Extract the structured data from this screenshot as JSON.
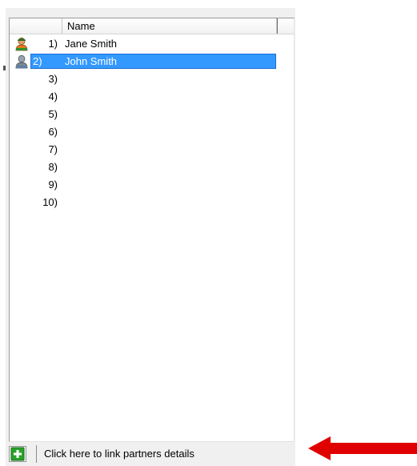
{
  "listview": {
    "column_header": "Name",
    "rows": [
      {
        "number": "1)",
        "name": "Jane Smith",
        "icon": "person-orange-icon",
        "selected": false
      },
      {
        "number": "2)",
        "name": "John Smith",
        "icon": "person-grey-icon",
        "selected": true
      },
      {
        "number": "3)",
        "name": ""
      },
      {
        "number": "4)",
        "name": ""
      },
      {
        "number": "5)",
        "name": ""
      },
      {
        "number": "6)",
        "name": ""
      },
      {
        "number": "7)",
        "name": ""
      },
      {
        "number": "8)",
        "name": ""
      },
      {
        "number": "9)",
        "name": ""
      },
      {
        "number": "10)",
        "name": ""
      }
    ]
  },
  "footer": {
    "link_label": "Click here to link partners details",
    "add_icon": "plus-icon"
  },
  "colors": {
    "selection": "#3399ff",
    "add_icon_green": "#2aa12a",
    "arrow_red": "#e00000"
  }
}
